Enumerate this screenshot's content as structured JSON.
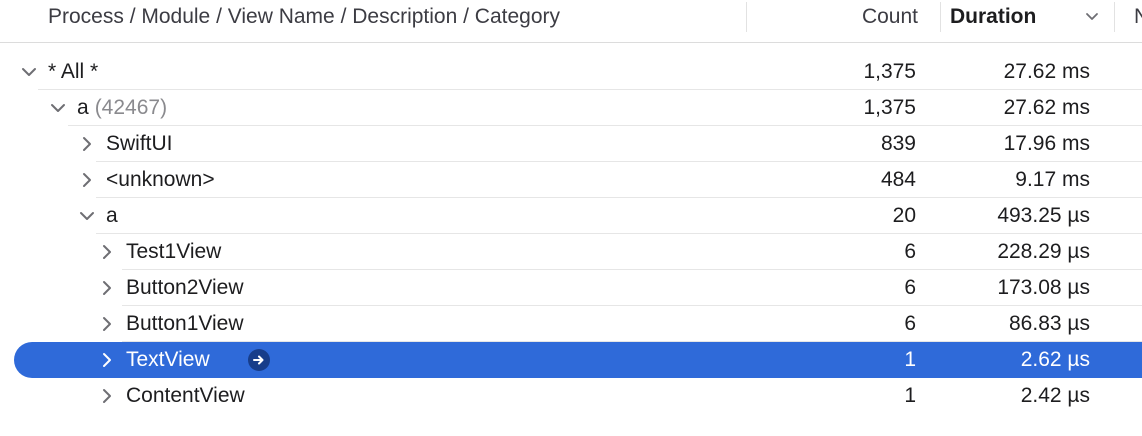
{
  "header": {
    "name_col": "Process / Module / View Name / Description / Category",
    "count_col": "Count",
    "duration_col": "Duration",
    "next_col": "N"
  },
  "rows": [
    {
      "label": "* All *",
      "pid": "",
      "count": "1,375",
      "duration": "27.62 ms",
      "expanded": true,
      "selected": false
    },
    {
      "label": "a",
      "pid": "(42467)",
      "count": "1,375",
      "duration": "27.62 ms",
      "expanded": true,
      "selected": false
    },
    {
      "label": "SwiftUI",
      "pid": "",
      "count": "839",
      "duration": "17.96 ms",
      "expanded": false,
      "selected": false
    },
    {
      "label": "<unknown>",
      "pid": "",
      "count": "484",
      "duration": "9.17 ms",
      "expanded": false,
      "selected": false
    },
    {
      "label": "a",
      "pid": "",
      "count": "20",
      "duration": "493.25 µs",
      "expanded": true,
      "selected": false
    },
    {
      "label": "Test1View",
      "pid": "",
      "count": "6",
      "duration": "228.29 µs",
      "expanded": false,
      "selected": false
    },
    {
      "label": "Button2View",
      "pid": "",
      "count": "6",
      "duration": "173.08 µs",
      "expanded": false,
      "selected": false
    },
    {
      "label": "Button1View",
      "pid": "",
      "count": "6",
      "duration": "86.83 µs",
      "expanded": false,
      "selected": false
    },
    {
      "label": "TextView",
      "pid": "",
      "count": "1",
      "duration": "2.62 µs",
      "expanded": false,
      "selected": true
    },
    {
      "label": "ContentView",
      "pid": "",
      "count": "1",
      "duration": "2.42 µs",
      "expanded": false,
      "selected": false
    }
  ],
  "colors": {
    "selection": "#2f6ad9",
    "goto_button": "#173d8a",
    "pid_text": "#8a8a8e"
  },
  "icons": {
    "expanded": "chevron-down-icon",
    "collapsed": "chevron-right-icon",
    "goto": "arrow-circle-right-icon",
    "sort": "chevron-down-icon"
  }
}
